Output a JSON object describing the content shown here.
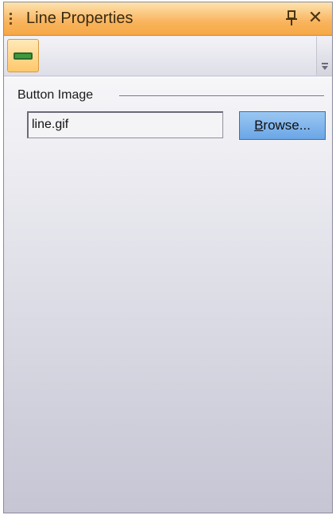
{
  "window": {
    "title": "Line Properties"
  },
  "toolbar": {
    "items": [
      {
        "icon": "line-icon",
        "selected": true
      }
    ]
  },
  "group": {
    "label": "Button Image"
  },
  "image_field": {
    "value": "line.gif"
  },
  "browse_button": {
    "label_mnemonic": "B",
    "label_rest": "rowse..."
  },
  "colors": {
    "titlebar": "#f9b45d",
    "selected_tool": "#ffc86a",
    "browse_button": "#6aa6e6",
    "panel_background": "#e2e2ea"
  }
}
